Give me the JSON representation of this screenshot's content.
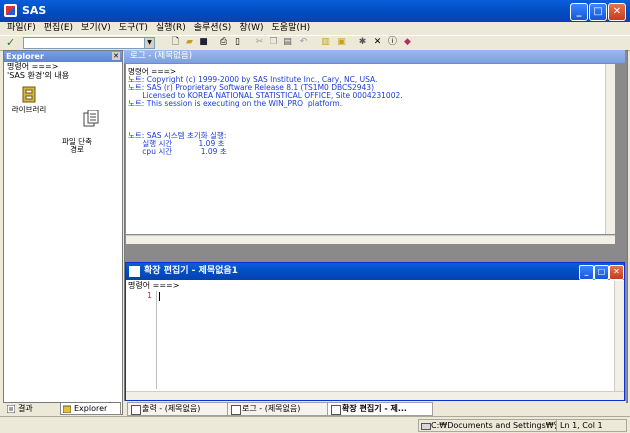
{
  "app": {
    "title": "SAS"
  },
  "menu": [
    "파일(F)",
    "편집(E)",
    "보기(V)",
    "도구(T)",
    "실행(R)",
    "솔루션(S)",
    "창(W)",
    "도움말(H)"
  ],
  "toolbar": {
    "command_value": ""
  },
  "explorer": {
    "title": "Explorer",
    "path_line1": "명령어 ===>",
    "path_line2": "'SAS 환경'의 내용",
    "items": [
      {
        "label": "라이브러리"
      },
      {
        "label": "파일 단축\n경로"
      }
    ],
    "tabs": [
      {
        "label": "결과"
      },
      {
        "label": "Explorer"
      }
    ]
  },
  "log": {
    "title": "로그 - (제목없음)",
    "lines": [
      {
        "text": "명령어 ===>",
        "color": "black"
      },
      {
        "text": "노트: Copyright (c) 1999-2000 by SAS Institute Inc., Cary, NC, USA.",
        "color": "blue"
      },
      {
        "text": "노트: SAS (r) Proprietary Software Release 8.1 (TS1M0 DBCS2943)",
        "color": "blue"
      },
      {
        "text": "      Licensed to KOREA NATIONAL STATISTICAL OFFICE, Site 0004231002.",
        "color": "blue"
      },
      {
        "text": "노트: This session is executing on the WIN_PRO  platform.",
        "color": "blue"
      },
      {
        "text": "",
        "color": "blue"
      },
      {
        "text": "",
        "color": "blue"
      },
      {
        "text": "",
        "color": "blue"
      },
      {
        "text": "노트: SAS 시스템 초기화 실행:",
        "color": "blue"
      },
      {
        "text": "      실행 시간           1.09 초",
        "color": "blue"
      },
      {
        "text": "      cpu 시간            1.09 초",
        "color": "blue"
      }
    ]
  },
  "editor": {
    "title": "확장 편집기 - 제목없음1",
    "command_line": "명령어 ===>",
    "line_number": "1"
  },
  "task_tabs": [
    {
      "label": "출력 - (제목없음)",
      "active": false
    },
    {
      "label": "로그 - (제목없음)",
      "active": false
    },
    {
      "label": "확장 편집기 - 제...",
      "active": true
    }
  ],
  "status": {
    "path": "C:₩Documents and Settings₩일반",
    "position": "Ln 1, Col 1"
  }
}
